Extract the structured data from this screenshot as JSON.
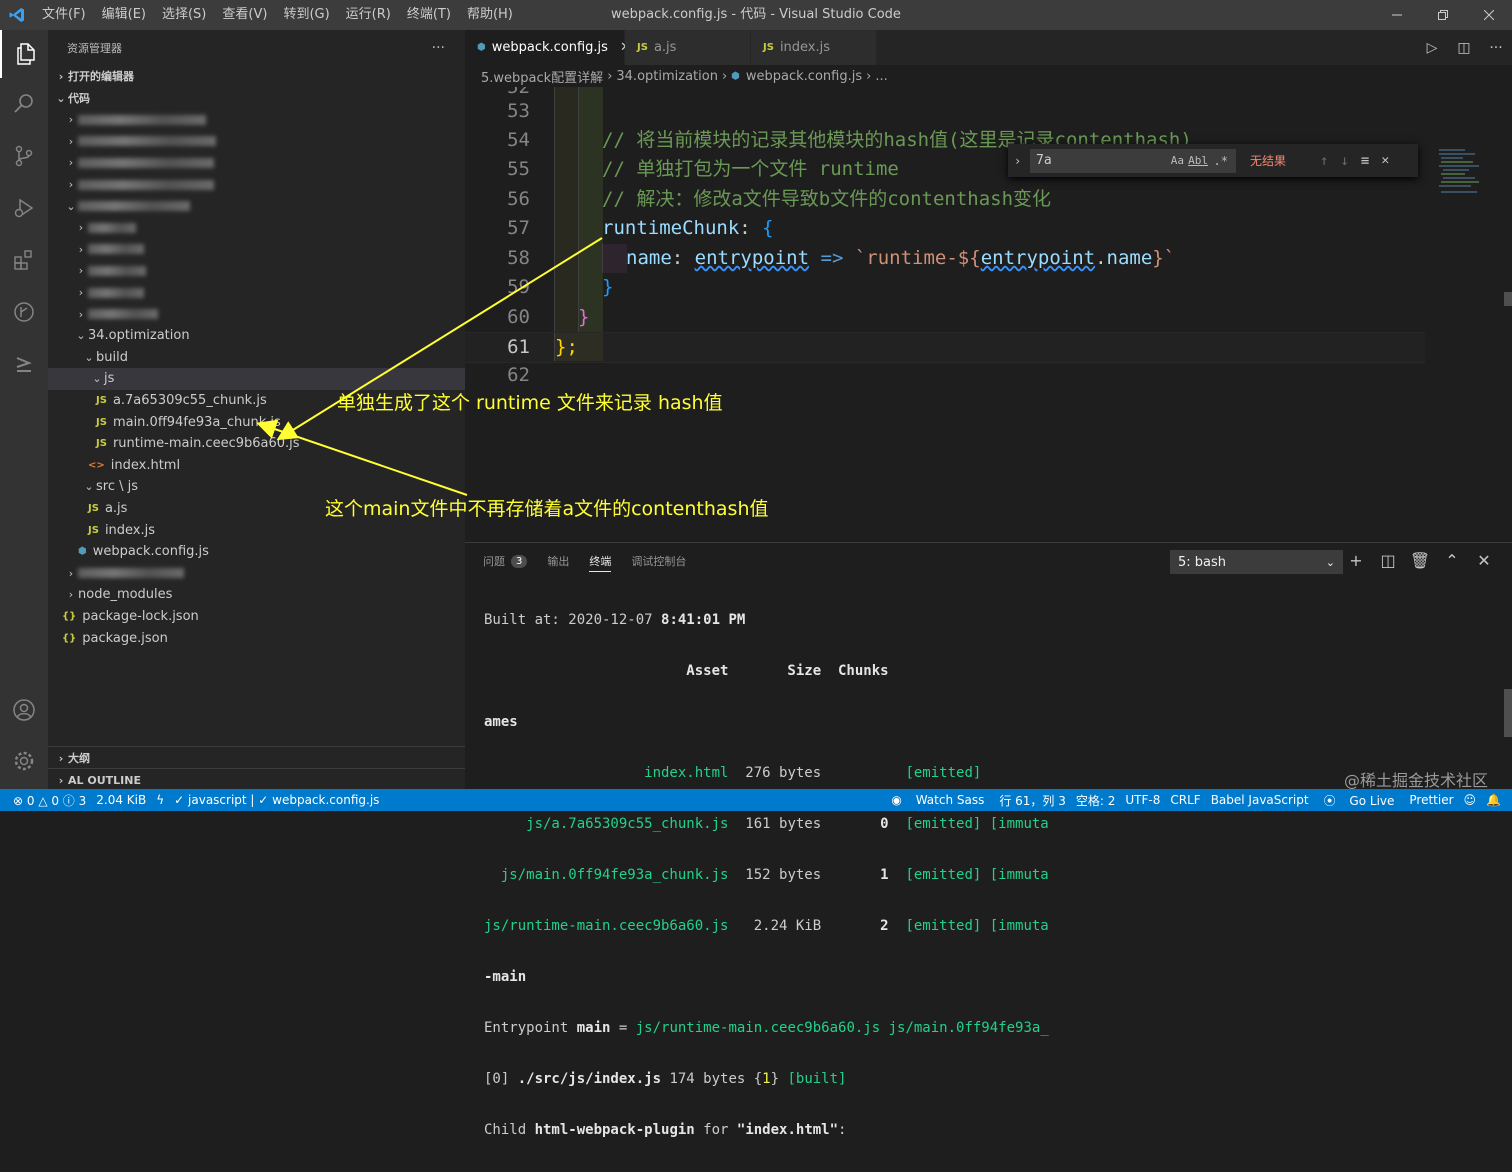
{
  "window": {
    "title": "webpack.config.js - 代码 - Visual Studio Code"
  },
  "menu": [
    "文件(F)",
    "编辑(E)",
    "选择(S)",
    "查看(V)",
    "转到(G)",
    "运行(R)",
    "终端(T)",
    "帮助(H)"
  ],
  "sidebar": {
    "title": "资源管理器",
    "more": "···",
    "open_editors": "打开的编辑器",
    "folder": "代码",
    "tree": {
      "optimization": "34.optimization",
      "build": "build",
      "js": "js",
      "file1": "a.7a65309c55_chunk.js",
      "file2": "main.0ff94fe93a_chunk.js",
      "file3": "runtime-main.ceec9b6a60.js",
      "index_html": "index.html",
      "src_js": "src \\ js",
      "a_js": "a.js",
      "index_js": "index.js",
      "webpack_config": "webpack.config.js",
      "node_modules": "node_modules",
      "package_lock": "package-lock.json",
      "package_json": "package.json"
    },
    "outline": "大纲",
    "al_outline": "AL OUTLINE"
  },
  "tabs": [
    "webpack.config.js",
    "a.js",
    "index.js"
  ],
  "breadcrumb": {
    "p1": "5.webpack配置详解",
    "p2": "34.optimization",
    "p3": "webpack.config.js",
    "p4": "..."
  },
  "find": {
    "value": "7a",
    "aa": "Aa",
    "ab": "Abl",
    "result": "无结果"
  },
  "code": {
    "line_numbers": [
      "52",
      "53",
      "54",
      "55",
      "56",
      "57",
      "58",
      "59",
      "60",
      "61",
      "62"
    ],
    "c54": "// 将当前模块的记录其他模块的hash值(这里是记录contenthash)",
    "c55": "// 单独打包为一个文件 runtime",
    "c56": "// 解决：修改a文件导致b文件的contenthash变化",
    "c57_key": "runtimeChunk",
    "c57_rest": ": ",
    "c58_key": "name",
    "c58_param": "entrypoint",
    "c58_arrow": "=>",
    "c58_str1": "`runtime-${",
    "c58_obj": "entrypoint",
    "c58_dot": ".",
    "c58_prop": "name",
    "c58_str2": "}`",
    "brace_open": "{",
    "brace_close": "}",
    "c61": "};",
    "colon": ": "
  },
  "panel": {
    "tabs": [
      "问题",
      "输出",
      "终端",
      "调试控制台"
    ],
    "problems_count": "3",
    "terminal_select": "5: bash",
    "lines": {
      "l1a": "Built at: 2020-12-07 ",
      "l1b": "8:41:01 PM",
      "l2": "                        Asset       Size  Chunks",
      "l3": "ames",
      "l4a": "                   index.html",
      "l4b": "  276 bytes          ",
      "l4c": "[emitted]",
      "l5a": "     js/a.7a65309c55_chunk.js",
      "l5b": "  161 bytes       ",
      "l5c": "0",
      "l5d": "  [emitted] [immuta",
      "l6a": "  js/main.0ff94fe93a_chunk.js",
      "l6b": "  152 bytes       ",
      "l6c": "1",
      "l6d": "  [emitted] [immuta",
      "l7a": "js/runtime-main.ceec9b6a60.js",
      "l7b": "   2.24 KiB       ",
      "l7c": "2",
      "l7d": "  [emitted] [immuta",
      "l8": "-main",
      "l9a": "Entrypoint ",
      "l9b": "main",
      "l9c": " = ",
      "l9d": "js/runtime-main.ceec9b6a60.js js/main.0ff94fe93a_",
      "l10a": "[0] ",
      "l10b": "./src/js/index.js",
      "l10c": " 174 bytes {",
      "l10d": "1",
      "l10e": "} ",
      "l10f": "[built]",
      "l11a": "Child ",
      "l11b": "html-webpack-plugin",
      "l11c": " for ",
      "l11d": "\"index.html\"",
      "l11e": ":"
    }
  },
  "annotations": {
    "a1": "单独生成了这个 runtime 文件来记录 hash值",
    "a2": "这个main文件中不再存储着a文件的contenthash值"
  },
  "watermark": "@稀土掘金技术社区",
  "status": {
    "errors": "⊗ 0 △ 0 ⓘ 3",
    "size": "2.04 KiB",
    "lang_mode": "✓ javascript | ✓ webpack.config.js",
    "watch": "Watch Sass",
    "pos": "行 61，列 3",
    "spaces": "空格: 2",
    "enc": "UTF-8",
    "eol": "CRLF",
    "lang": "Babel JavaScript",
    "golive": "Go Live",
    "prettier": "Prettier"
  },
  "colors": {
    "accent": "#007acc",
    "annotation": "#ffff33",
    "terminal_green": "#23d18b"
  }
}
